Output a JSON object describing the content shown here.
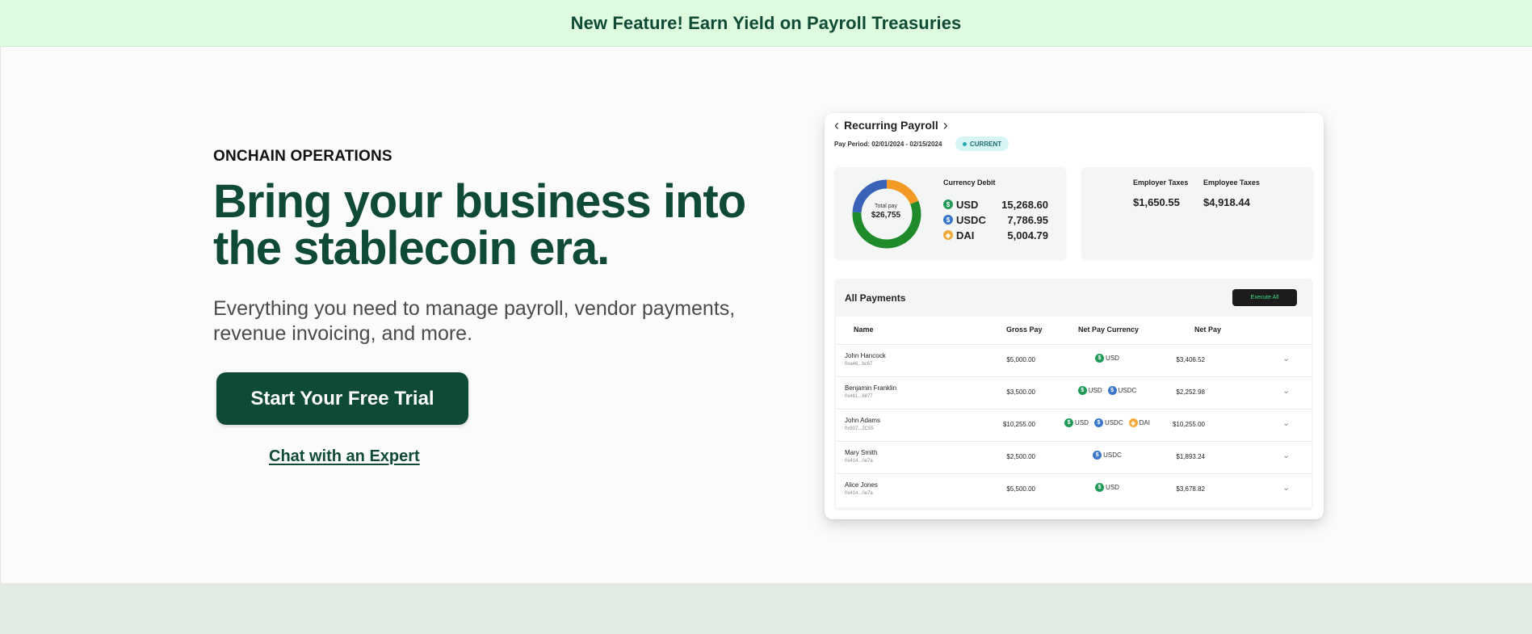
{
  "banner": {
    "text": "New Feature! Earn Yield on Payroll Treasuries"
  },
  "hero": {
    "eyebrow": "ONCHAIN OPERATIONS",
    "headline_line1": "Bring your business into",
    "headline_line2": "the stablecoin era.",
    "subtext_line1": "Everything you need to manage payroll, vendor payments,",
    "subtext_line2": "revenue invoicing, and more.",
    "cta_label": "Start Your Free Trial",
    "chat_link": "Chat with an Expert"
  },
  "card": {
    "title": "Recurring Payroll",
    "pay_period": "Pay Period: 02/01/2024 - 02/15/2024",
    "status": "CURRENT",
    "total_pay_label": "Total pay",
    "total_pay_value": "$26,755",
    "currency_debit_title": "Currency Debit",
    "currencies": [
      {
        "name": "USD",
        "amount": "15,268.60",
        "icon": "usd-coin-icon",
        "color": "#1f9a57"
      },
      {
        "name": "USDC",
        "amount": "7,786.95",
        "icon": "usdc-coin-icon",
        "color": "#3a76c9"
      },
      {
        "name": "DAI",
        "amount": "5,004.79",
        "icon": "dai-coin-icon",
        "color": "#f3a93a"
      }
    ],
    "employer_taxes_label": "Employer Taxes",
    "employer_taxes_value": "$1,650.55",
    "employee_taxes_label": "Employee Taxes",
    "employee_taxes_value": "$4,918.44",
    "all_payments_title": "All Payments",
    "execute_all_label": "Execute All",
    "columns": [
      "Name",
      "Gross Pay",
      "Net Pay Currency",
      "Net Pay"
    ],
    "rows": [
      {
        "name": "John Hancock",
        "address": "0xa46...bc67",
        "gross": "$5,000.00",
        "currencies": [
          "USD"
        ],
        "net": "$3,406.52"
      },
      {
        "name": "Benjamin Franklin",
        "address": "0x4b1...6877",
        "gross": "$3,500.00",
        "currencies": [
          "USD",
          "USDC"
        ],
        "net": "$2,252.98"
      },
      {
        "name": "John Adams",
        "address": "0x937...2C55",
        "gross": "$10,255.00",
        "currencies": [
          "USD",
          "USDC",
          "DAI"
        ],
        "net": "$10,255.00"
      },
      {
        "name": "Mary Smith",
        "address": "0x414...0e7a",
        "gross": "$2,500.00",
        "currencies": [
          "USDC"
        ],
        "net": "$1,893.24"
      },
      {
        "name": "Alice Jones",
        "address": "0x414...0e7a",
        "gross": "$5,500.00",
        "currencies": [
          "USD"
        ],
        "net": "$3,678.82"
      }
    ]
  },
  "colors": {
    "brand": "#0f4a35",
    "banner_bg": "#defbdf",
    "donut_usd": "#1e8a2a",
    "donut_usdc": "#3a62b7",
    "donut_dai": "#f39a25"
  },
  "donut_shares": {
    "usd": 0.571,
    "usdc": 0.291,
    "dai": 0.187
  }
}
